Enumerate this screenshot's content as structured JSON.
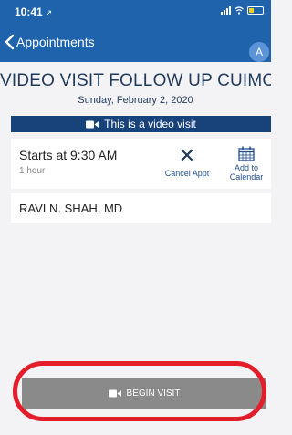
{
  "status": {
    "time": "10:41",
    "location_glyph": "↗"
  },
  "nav": {
    "back_label": "Appointments",
    "avatar_initial": "A"
  },
  "visit": {
    "title": "VIDEO VISIT FOLLOW UP CUIMC",
    "date": "Sunday, February 2, 2020",
    "banner": "This is a video visit"
  },
  "appointment": {
    "start": "Starts at 9:30 AM",
    "duration": "1 hour",
    "cancel_label": "Cancel Appt",
    "calendar_label_line1": "Add to",
    "calendar_label_line2": "Calendar"
  },
  "provider": {
    "name": "RAVI N. SHAH, MD"
  },
  "begin": {
    "label": "BEGIN VISIT"
  },
  "colors": {
    "nav": "#1f63ad",
    "banner": "#17427a",
    "button": "#8a8a8a",
    "highlight": "#e41d2a"
  },
  "icons": [
    "location-arrow-icon",
    "signal-icon",
    "wifi-icon",
    "battery-icon",
    "chevron-left-icon",
    "video-camera-icon",
    "close-icon",
    "calendar-icon"
  ]
}
